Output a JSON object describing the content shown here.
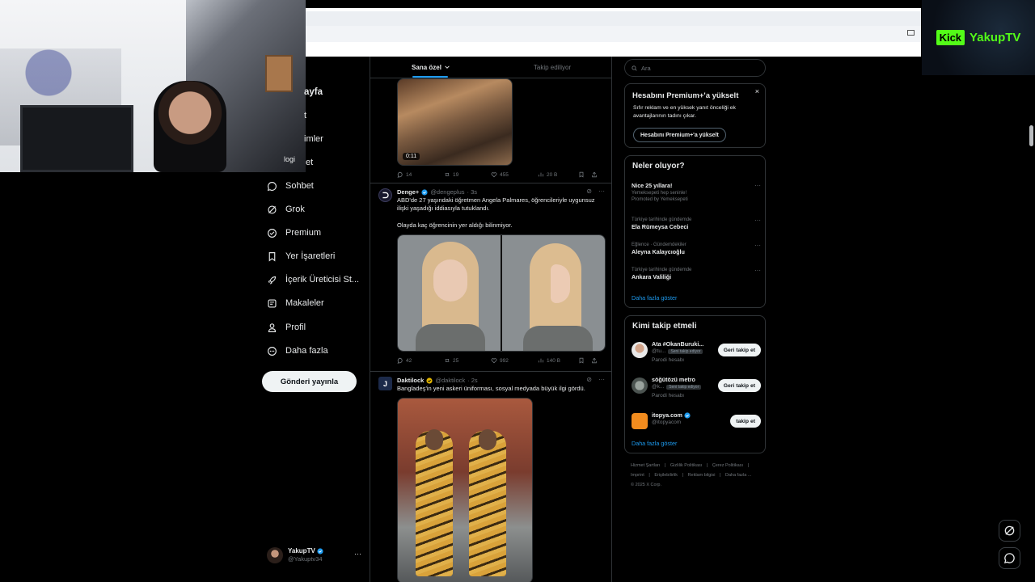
{
  "stream": {
    "platform_logo": "Kick",
    "channel": "YakupTV"
  },
  "nav": {
    "partials": {
      "home": "ayfa",
      "explore": "t",
      "notifications": "imler",
      "messages": "et",
      "overlap_text": "logi"
    },
    "items": [
      {
        "label": "Sohbet",
        "icon": "chat-icon"
      },
      {
        "label": "Grok",
        "icon": "grok-icon"
      },
      {
        "label": "Premium",
        "icon": "premium-icon"
      },
      {
        "label": "Yer İşaretleri",
        "icon": "bookmark-icon"
      },
      {
        "label": "İçerik Üreticisi St...",
        "icon": "rocket-icon"
      },
      {
        "label": "Makaleler",
        "icon": "article-icon"
      },
      {
        "label": "Profil",
        "icon": "person-icon"
      },
      {
        "label": "Daha fazla",
        "icon": "more-circle-icon"
      }
    ],
    "post_button": "Gönderi yayınla",
    "account": {
      "name": "YakupTV",
      "handle": "@Yakuptv34",
      "more": "···"
    }
  },
  "timeline": {
    "tabs": [
      {
        "label": "Sana özel",
        "active": true
      },
      {
        "label": "Takip ediliyor",
        "active": false
      }
    ],
    "tweets": [
      {
        "media_badge": "0:11",
        "stats": {
          "replies": "14",
          "reposts": "19",
          "likes": "455",
          "views": "20 B"
        }
      },
      {
        "name": "Denge+",
        "handle": "@dengeplus",
        "time": "· 3s",
        "text_line1": "ABD'de 27 yaşındaki öğretmen Angela Palmares, öğrencileriyle uygunsuz ilişki yaşadığı iddiasıyla tutuklandı.",
        "text_line2": "Olayda kaç öğrencinin yer aldığı bilinmiyor.",
        "stats": {
          "replies": "42",
          "reposts": "25",
          "likes": "992",
          "views": "140 B"
        }
      },
      {
        "name": "Daktilock",
        "handle": "@daktilock",
        "time": "· 2s",
        "text": "Bangladeş'in yeni askeri üniforması, sosyal medyada büyük ilgi gördü."
      }
    ]
  },
  "sidebar": {
    "search_placeholder": "Ara",
    "premium": {
      "title": "Hesabını Premium+'a yükselt",
      "desc": "Sıfır reklam ve en yüksek yanıt önceliği ek avantajlarının tadını çıkar.",
      "button": "Hesabını Premium+'a yükselt",
      "close": "×"
    },
    "trends": {
      "title": "Neler oluyor?",
      "items": [
        {
          "topic": "Nice 25 yıllara!",
          "meta1": "Yemeksepeti hep seninle!",
          "meta2": "Promoted by Yemeksepeti",
          "promoted": true
        },
        {
          "meta1": "Türkiye tarihinde gündemde",
          "topic": "Ela Rümeysa Cebeci"
        },
        {
          "meta1": "Eğlence · Gündemdekiler",
          "topic": "Aleyna Kalaycıoğlu"
        },
        {
          "meta1": "Türkiye tarihinde gündemde",
          "topic": "Ankara Valiliği"
        }
      ],
      "show_more": "Daha fazla göster"
    },
    "who_to_follow": {
      "title": "Kimi takip etmeli",
      "items": [
        {
          "name": "Ata #OkanBuruki...",
          "handle": "@tu...",
          "chip": "Seni takip ediyor",
          "parody": "Parodi hesabı",
          "button": "Geri takip et"
        },
        {
          "name": "söğütözü metro",
          "handle": "@k...",
          "chip": "Seni takip ediyor",
          "parody": "Parodi hesabı",
          "button": "Geri takip et"
        },
        {
          "name": "itopya.com",
          "handle": "@itopyacom",
          "button": "takip et"
        }
      ],
      "show_more": "Daha fazla göster"
    },
    "footer": {
      "line1": [
        "Hizmet Şartları",
        "|",
        "Gizlilik Politikası",
        "|",
        "Çerez Politikası",
        "|"
      ],
      "line2": [
        "Imprint",
        "|",
        "Erişilebilirlik",
        "|",
        "Reklam bilgisi",
        "|",
        "Daha fazla ..."
      ],
      "copyright": "© 2025 X Corp."
    }
  },
  "colors": {
    "accent": "#1d9bf0",
    "kick_green": "#53fc18",
    "border": "#2f3336",
    "muted": "#71767b"
  }
}
